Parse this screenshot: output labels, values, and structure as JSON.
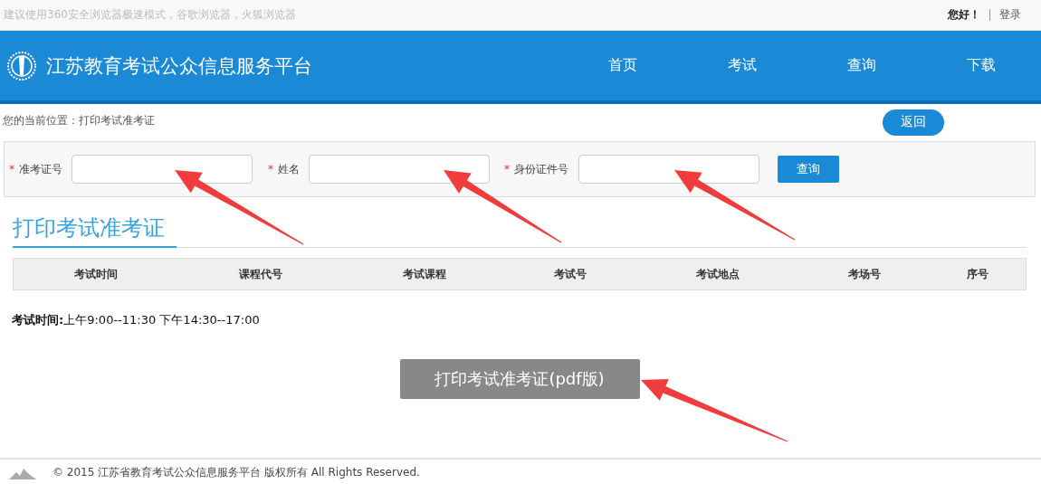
{
  "top_bar": {
    "notice": "建议使用360安全浏览器极速模式，谷歌浏览器，火狐浏览器",
    "greeting": "您好！",
    "login_link": "登录"
  },
  "header": {
    "title": "江苏教育考试公众信息服务平台",
    "nav": [
      {
        "label": "首页"
      },
      {
        "label": "考试"
      },
      {
        "label": "查询"
      },
      {
        "label": "下载"
      }
    ]
  },
  "breadcrumb": "您的当前位置：打印考试准考证",
  "back_button": "返回",
  "form": {
    "fields": [
      {
        "mark": "*",
        "label": "准考证号"
      },
      {
        "mark": "*",
        "label": "姓名"
      },
      {
        "mark": "*",
        "label": "身份证件号"
      }
    ],
    "submit": "查询"
  },
  "section_title": "打印考试准考证",
  "table": {
    "columns": [
      "考试时间",
      "课程代号",
      "考试课程",
      "考试号",
      "考试地点",
      "考场号",
      "序号"
    ]
  },
  "note": {
    "label": "考试时间:",
    "text": "上午9:00--11:30 下午14:30--17:00"
  },
  "print_button": "打印考试准考证(pdf版)",
  "footer": {
    "copyright": "© 2015 江苏省教育考试公众信息服务平台 版权所有 All Rights Reserved."
  }
}
